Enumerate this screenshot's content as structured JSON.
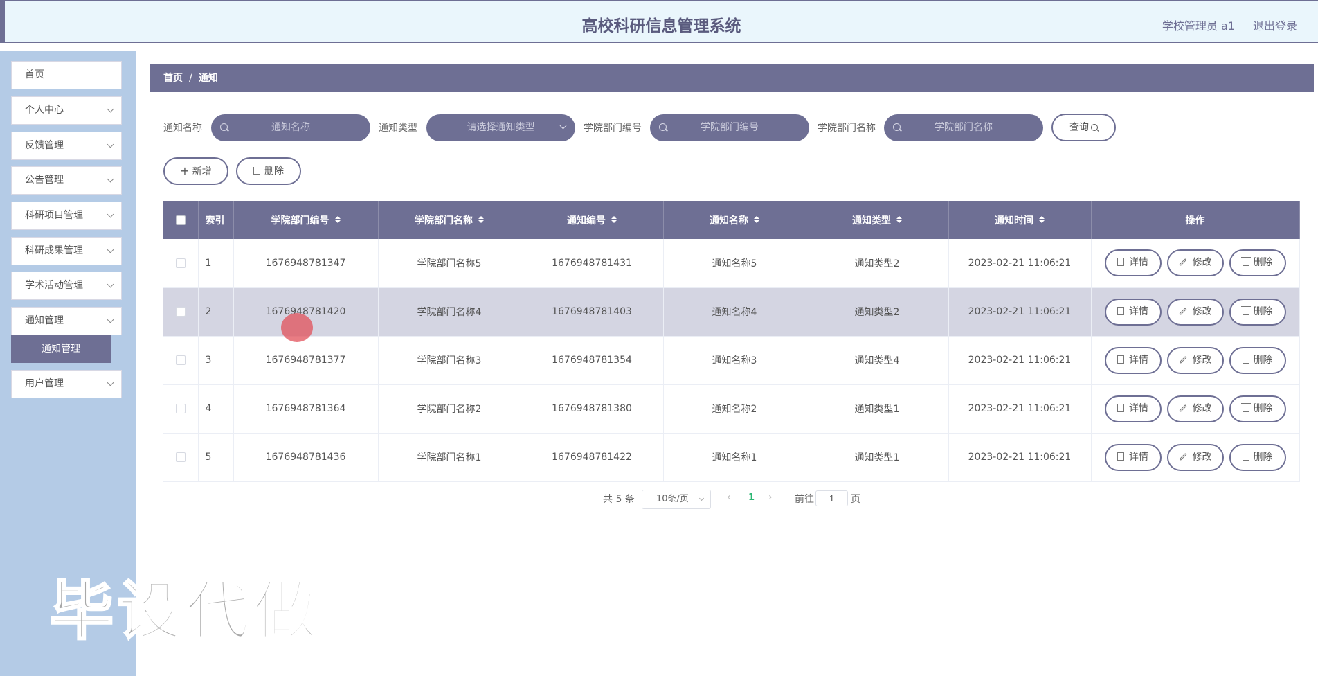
{
  "header": {
    "title": "高校科研信息管理系统",
    "user": "学校管理员 a1",
    "logout": "退出登录"
  },
  "sidebar": {
    "items": [
      {
        "label": "首页",
        "expandable": false
      },
      {
        "label": "个人中心",
        "expandable": true
      },
      {
        "label": "反馈管理",
        "expandable": true
      },
      {
        "label": "公告管理",
        "expandable": true
      },
      {
        "label": "科研项目管理",
        "expandable": true
      },
      {
        "label": "科研成果管理",
        "expandable": true
      },
      {
        "label": "学术活动管理",
        "expandable": true
      },
      {
        "label": "通知管理",
        "expandable": true
      },
      {
        "label": "用户管理",
        "expandable": true
      }
    ],
    "active_submenu": "通知管理"
  },
  "breadcrumb": {
    "home": "首页",
    "separator": "/",
    "current": "通知"
  },
  "search": {
    "fields": [
      {
        "label": "通知名称",
        "placeholder": "通知名称"
      },
      {
        "label": "通知类型",
        "placeholder": "请选择通知类型"
      },
      {
        "label": "学院部门编号",
        "placeholder": "学院部门编号"
      },
      {
        "label": "学院部门名称",
        "placeholder": "学院部门名称"
      }
    ],
    "query_label": "查询"
  },
  "actions": {
    "add": "新增",
    "delete": "删除"
  },
  "table": {
    "columns": [
      "索引",
      "学院部门编号",
      "学院部门名称",
      "通知编号",
      "通知名称",
      "通知类型",
      "通知时间",
      "操作"
    ],
    "rows": [
      [
        "1",
        "1676948781347",
        "学院部门名称5",
        "1676948781431",
        "通知名称5",
        "通知类型2",
        "2023-02-21 11:06:21"
      ],
      [
        "2",
        "1676948781420",
        "学院部门名称4",
        "1676948781403",
        "通知名称4",
        "通知类型2",
        "2023-02-21 11:06:21"
      ],
      [
        "3",
        "1676948781377",
        "学院部门名称3",
        "1676948781354",
        "通知名称3",
        "通知类型4",
        "2023-02-21 11:06:21"
      ],
      [
        "4",
        "1676948781364",
        "学院部门名称2",
        "1676948781380",
        "通知名称2",
        "通知类型1",
        "2023-02-21 11:06:21"
      ],
      [
        "5",
        "1676948781436",
        "学院部门名称1",
        "1676948781422",
        "通知名称1",
        "通知类型1",
        "2023-02-21 11:06:21"
      ]
    ],
    "highlighted_row": 1,
    "row_actions": {
      "detail": "详情",
      "edit": "修改",
      "delete": "删除"
    }
  },
  "pagination": {
    "total": "共 5 条",
    "page_size": "10条/页",
    "current_page": "1",
    "goto_prefix": "前往",
    "goto_value": "1",
    "goto_suffix": "页"
  },
  "watermark": "毕设代做",
  "colors": {
    "primary": "#6e6f94",
    "sidebar_bg": "#b4cbe6",
    "header_bg": "#eaf6fc",
    "active_page": "#2bb673",
    "row_highlight": "#d4d5e2"
  },
  "icons": [
    "search-icon",
    "chevron-down-icon",
    "plus-icon",
    "trash-icon",
    "document-icon",
    "pencil-icon",
    "sort-icon"
  ]
}
